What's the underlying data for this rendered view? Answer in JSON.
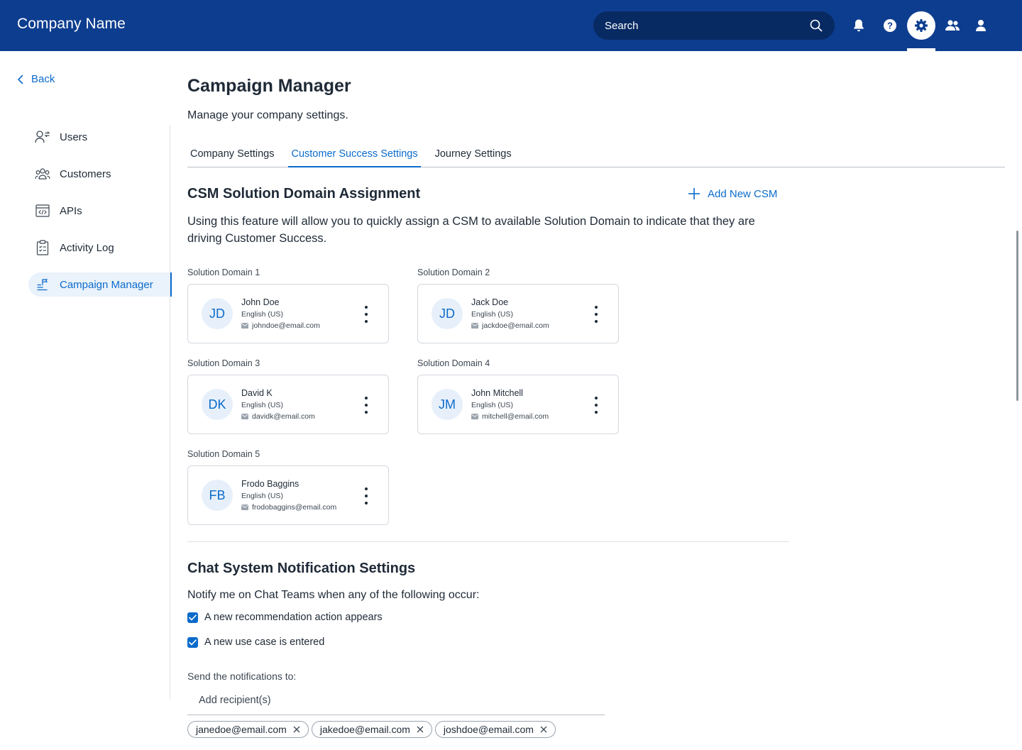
{
  "header": {
    "brand": "Company Name",
    "search_placeholder": "Search",
    "icons": [
      "bell-icon",
      "help-icon",
      "gear-icon",
      "people-icon",
      "user-icon"
    ]
  },
  "sidebar": {
    "back_label": "Back",
    "items": [
      {
        "label": "Users",
        "icon": "users-icon",
        "active": false
      },
      {
        "label": "Customers",
        "icon": "customers-icon",
        "active": false
      },
      {
        "label": "APIs",
        "icon": "api-icon",
        "active": false
      },
      {
        "label": "Activity Log",
        "icon": "clipboard-icon",
        "active": false
      },
      {
        "label": "Campaign Manager",
        "icon": "campaign-icon",
        "active": true
      }
    ]
  },
  "page": {
    "title": "Campaign Manager",
    "subtitle": "Manage your company settings.",
    "tabs": [
      {
        "label": "Company Settings",
        "active": false
      },
      {
        "label": "Customer Success Settings",
        "active": true
      },
      {
        "label": "Journey Settings",
        "active": false
      }
    ]
  },
  "csm": {
    "title": "CSM Solution Domain Assignment",
    "add_label": "Add New CSM",
    "description": "Using this feature will allow you to quickly assign a CSM to available Solution Domain to indicate that they are driving Customer Success.",
    "domains": [
      {
        "label": "Solution Domain 1",
        "initials": "JD",
        "name": "John Doe",
        "language": "English (US)",
        "email": "johndoe@email.com"
      },
      {
        "label": "Solution Domain 2",
        "initials": "JD",
        "name": "Jack Doe",
        "language": "English (US)",
        "email": "jackdoe@email.com"
      },
      {
        "label": "Solution Domain 3",
        "initials": "DK",
        "name": "David K",
        "language": "English (US)",
        "email": "davidk@email.com"
      },
      {
        "label": "Solution Domain 4",
        "initials": "JM",
        "name": "John Mitchell",
        "language": "English (US)",
        "email": "mitchell@email.com"
      },
      {
        "label": "Solution Domain 5",
        "initials": "FB",
        "name": "Frodo Baggins",
        "language": "English (US)",
        "email": "frodobaggins@email.com"
      }
    ]
  },
  "notifications": {
    "title": "Chat System Notification Settings",
    "lead": "Notify me on Chat Teams when any of the following occur:",
    "options": [
      {
        "label": "A new recommendation action appears",
        "checked": true
      },
      {
        "label": "A new use case is entered",
        "checked": true
      }
    ],
    "send_label": "Send the notifications to:",
    "recipient_placeholder": "Add recipient(s)",
    "recipients": [
      "janedoe@email.com",
      "jakedoe@email.com",
      "joshdoe@email.com"
    ]
  },
  "colors": {
    "header_bg": "#0d3d8f",
    "accent": "#0b6bcb"
  }
}
